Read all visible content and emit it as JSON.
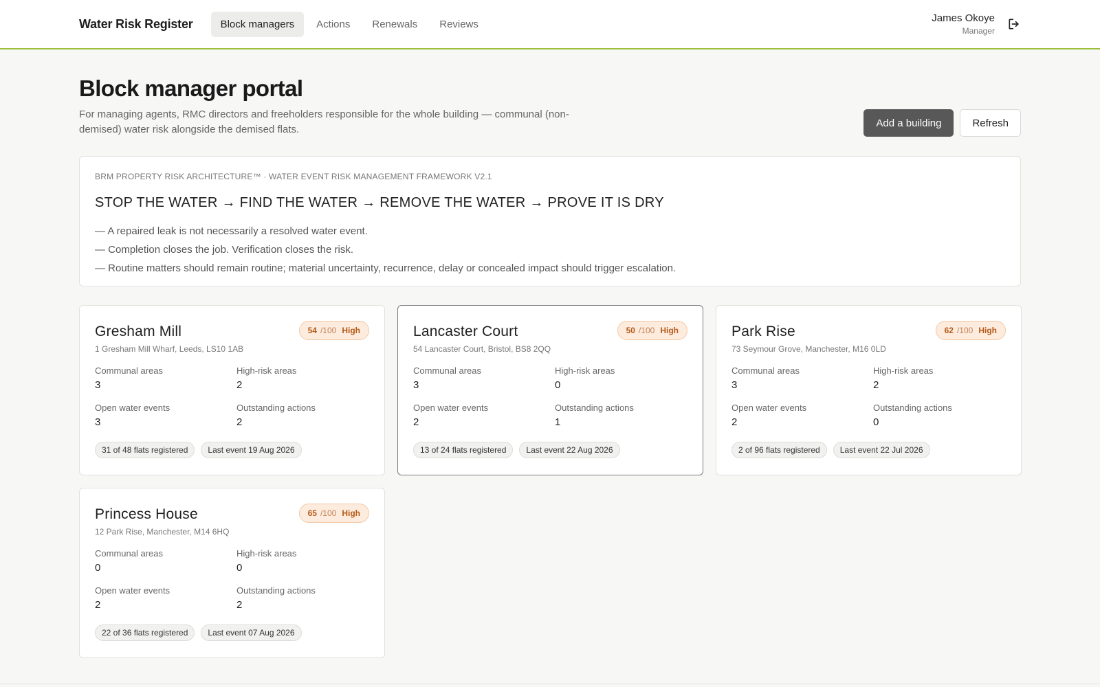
{
  "app": {
    "brand": "Water Risk Register",
    "nav": [
      {
        "label": "Block managers",
        "active": true
      },
      {
        "label": "Actions",
        "active": false
      },
      {
        "label": "Renewals",
        "active": false
      },
      {
        "label": "Reviews",
        "active": false
      }
    ],
    "user": {
      "name": "James Okoye",
      "role": "Manager",
      "logout_icon": "logout-icon"
    },
    "accent_color": "#9cbf3a"
  },
  "page": {
    "title": "Block manager portal",
    "description": "For managing agents, RMC directors and freeholders responsible for the whole building — communal (non-demised) water risk alongside the demised flats.",
    "add_button": "Add a building",
    "refresh_button": "Refresh"
  },
  "framework": {
    "eyebrow": "BRM PROPERTY RISK ARCHITECTURE™ · WATER EVENT RISK MANAGEMENT FRAMEWORK V2.1",
    "headline": "STOP THE WATER → FIND THE WATER → REMOVE THE WATER → PROVE IT IS DRY",
    "principles": [
      "— A repaired leak is not necessarily a resolved water event.",
      "— Completion closes the job. Verification closes the risk.",
      "— Routine matters should remain routine; material uncertainty, recurrence, delay or concealed impact should trigger escalation."
    ]
  },
  "stat_labels": {
    "communal": "Communal areas",
    "high_risk": "High-risk areas",
    "open_events": "Open water events",
    "outstanding": "Outstanding actions"
  },
  "score_suffix": "/100",
  "buildings": [
    {
      "name": "Gresham Mill",
      "address": "1 Gresham Mill Wharf, Leeds, LS10 1AB",
      "score": "54",
      "level": "High",
      "communal": "3",
      "high_risk": "2",
      "open_events": "3",
      "outstanding": "2",
      "flats": "31 of 48 flats registered",
      "last_event": "Last event 19 Aug 2026",
      "selected": false
    },
    {
      "name": "Lancaster Court",
      "address": "54 Lancaster Court, Bristol, BS8 2QQ",
      "score": "50",
      "level": "High",
      "communal": "3",
      "high_risk": "0",
      "open_events": "2",
      "outstanding": "1",
      "flats": "13 of 24 flats registered",
      "last_event": "Last event 22 Aug 2026",
      "selected": true
    },
    {
      "name": "Park Rise",
      "address": "73 Seymour Grove, Manchester, M16 0LD",
      "score": "62",
      "level": "High",
      "communal": "3",
      "high_risk": "2",
      "open_events": "2",
      "outstanding": "0",
      "flats": "2 of 96 flats registered",
      "last_event": "Last event 22 Jul 2026",
      "selected": false
    },
    {
      "name": "Princess House",
      "address": "12 Park Rise, Manchester, M14 6HQ",
      "score": "65",
      "level": "High",
      "communal": "0",
      "high_risk": "0",
      "open_events": "2",
      "outstanding": "2",
      "flats": "22 of 36 flats registered",
      "last_event": "Last event 07 Aug 2026",
      "selected": false
    }
  ]
}
